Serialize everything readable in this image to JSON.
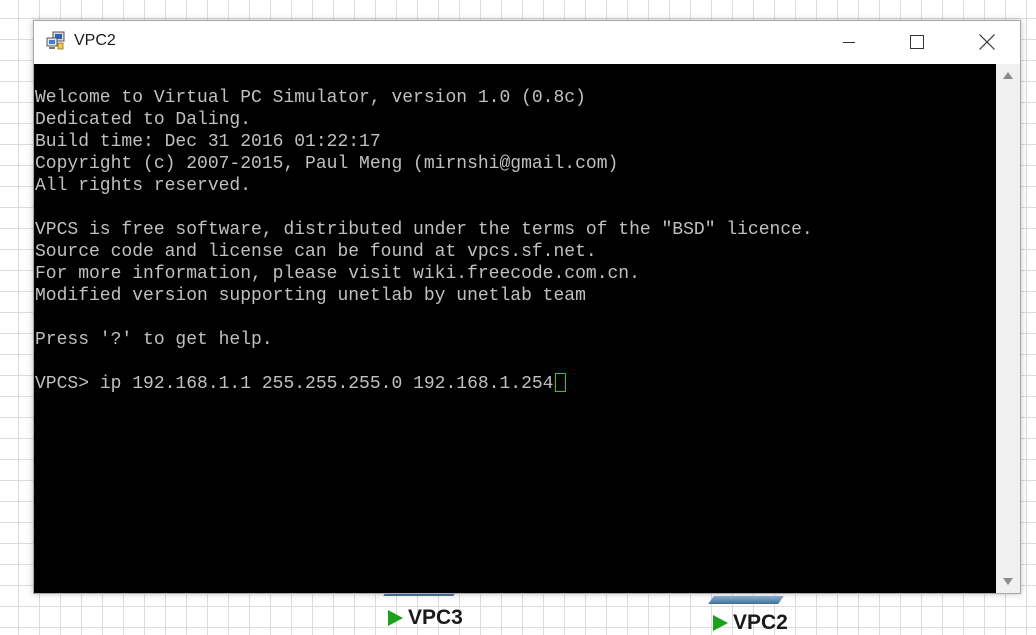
{
  "window": {
    "title": "VPC2",
    "icon": "computer-terminal-icon",
    "controls": [
      "minimize-icon",
      "maximize-icon",
      "close-icon"
    ]
  },
  "terminal": {
    "lines": [
      "Welcome to Virtual PC Simulator, version 1.0 (0.8c)",
      "Dedicated to Daling.",
      "Build time: Dec 31 2016 01:22:17",
      "Copyright (c) 2007-2015, Paul Meng (mirnshi@gmail.com)",
      "All rights reserved.",
      "",
      "VPCS is free software, distributed under the terms of the \"BSD\" licence.",
      "Source code and license can be found at vpcs.sf.net.",
      "For more information, please visit wiki.freecode.com.cn.",
      "Modified version supporting unetlab by unetlab team",
      "",
      "Press '?' to get help.",
      ""
    ],
    "prompt": "VPCS> ",
    "command": "ip 192.168.1.1 255.255.255.0 192.168.1.254",
    "background_color": "#000000",
    "text_color": "#c0c0c0",
    "cursor_color": "#19d419"
  },
  "background_nodes": [
    {
      "label": "VPC3",
      "status": "running",
      "status_icon": "play-icon",
      "status_color": "#1aa21a"
    },
    {
      "label": "VPC2",
      "status": "running",
      "status_icon": "play-icon",
      "status_color": "#1aa21a"
    }
  ]
}
